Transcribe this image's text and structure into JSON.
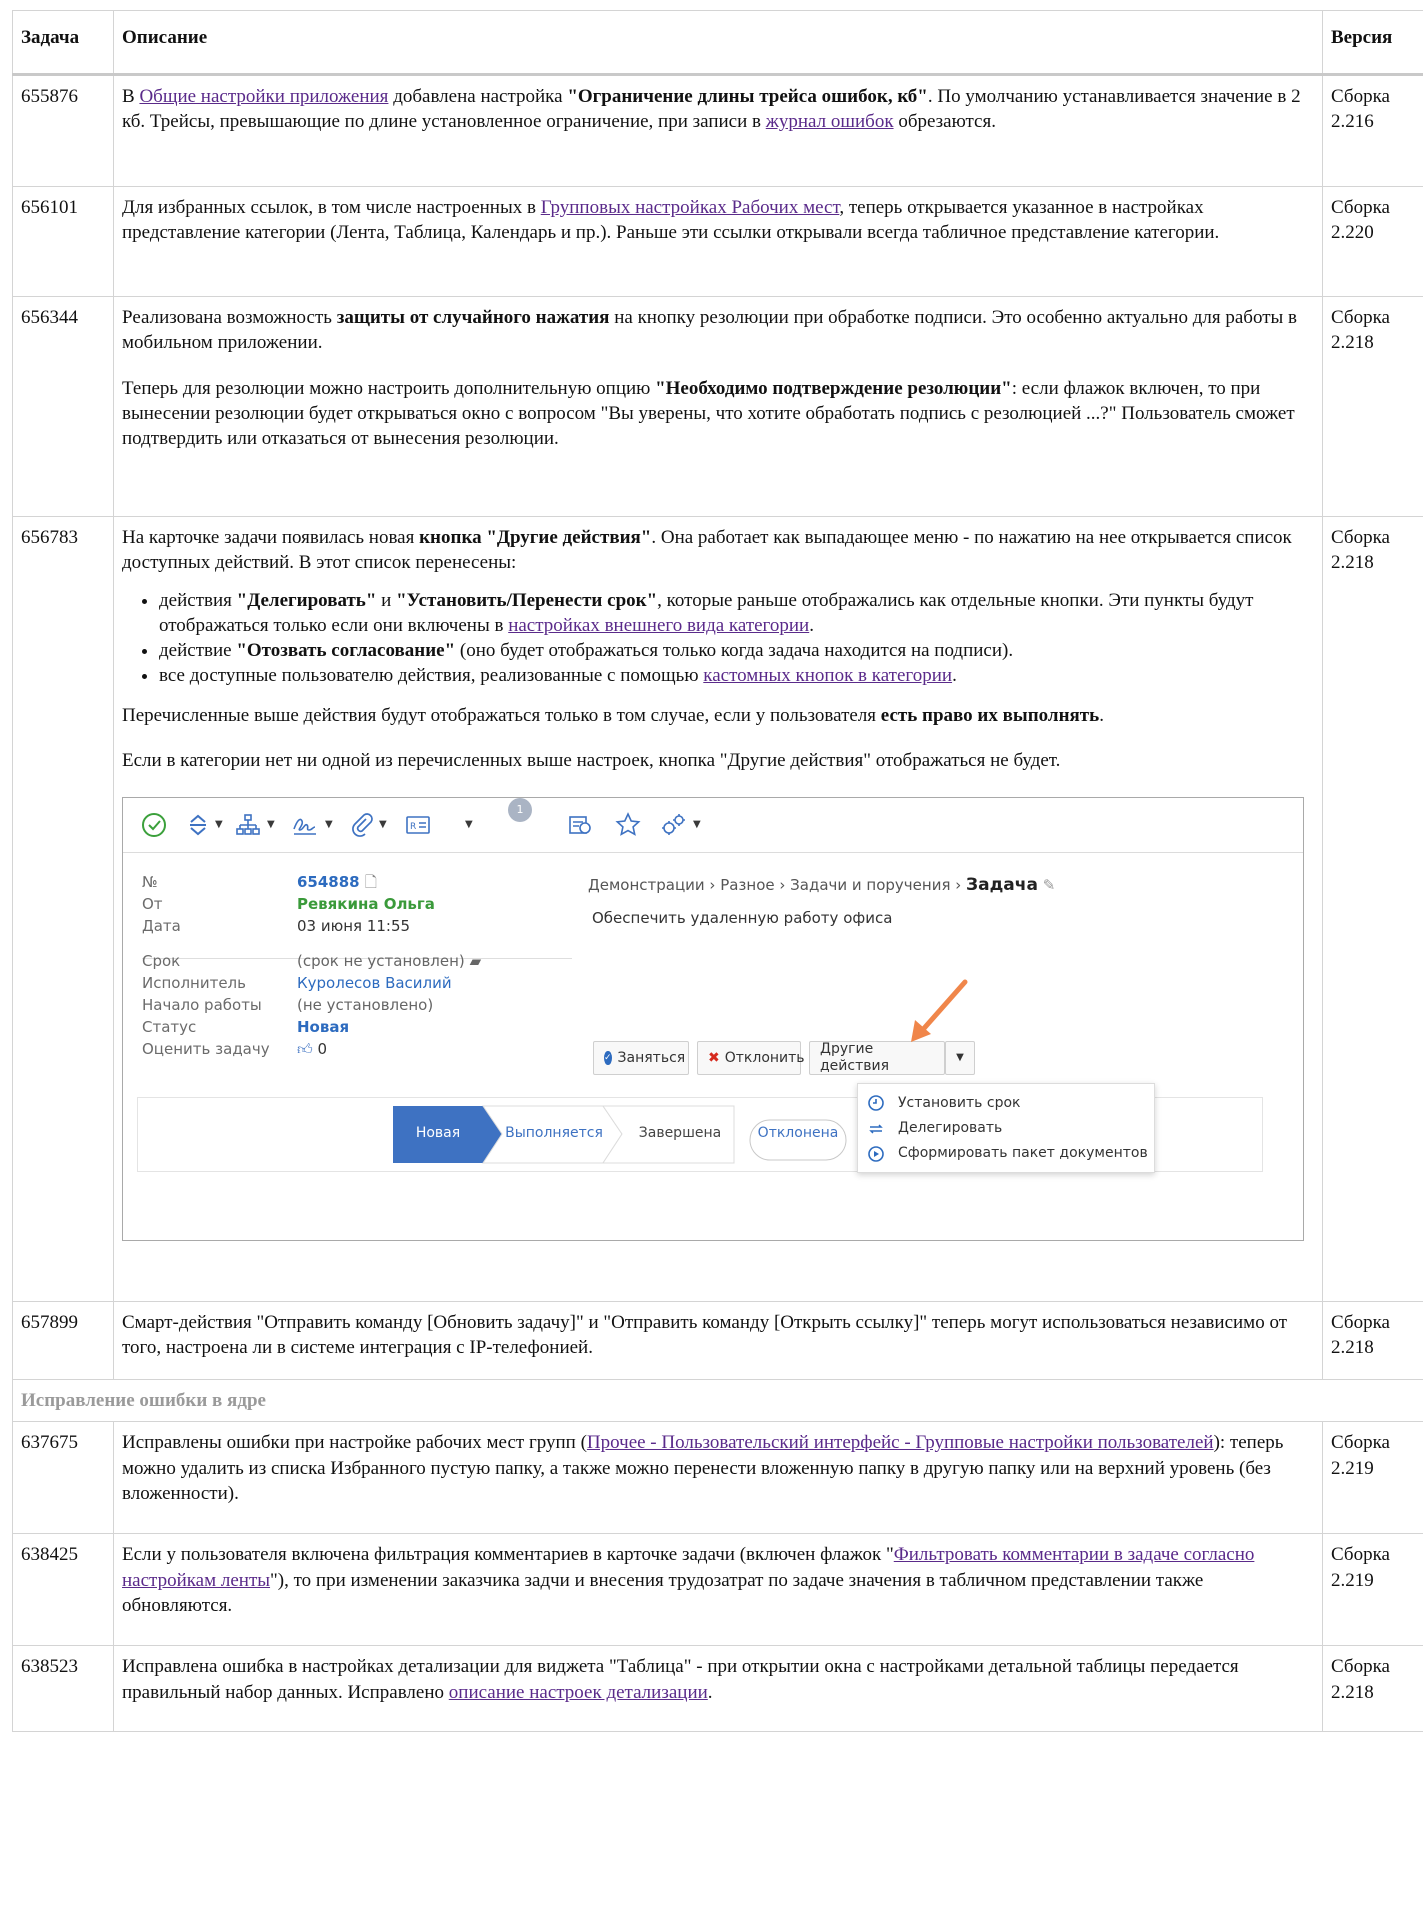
{
  "headers": {
    "task": "Задача",
    "desc": "Описание",
    "version": "Версия"
  },
  "rows": [
    {
      "id": "655876",
      "version": "Сборка 2.216",
      "p1a": "В ",
      "link1": "Общие настройки приложения",
      "p1b": " добавлена настройка ",
      "bold1": "\"Ограничение длины трейса ошибок, кб\"",
      "p1c": ". По умолчанию устанавливается значение в 2 кб. Трейсы, превышающие по длине установленное ограничение, при записи в ",
      "link2": "журнал ошибок",
      "p1d": " обрезаются."
    },
    {
      "id": "656101",
      "version": "Сборка 2.220",
      "p1a": "Для избранных ссылок, в том числе настроенных в ",
      "link1": "Групповых настройках Рабочих мест",
      "p1b": ", теперь открывается указанное в настройках представление категории (Лента, Таблица, Календарь и пр.). Раньше эти ссылки открывали всегда табличное представление категории."
    },
    {
      "id": "656344",
      "version": "Сборка 2.218",
      "p1a": "Реализована возможность ",
      "bold1": "защиты от случайного нажатия",
      "p1b": " на кнопку резолюции при обработке подписи. Это особенно актуально для работы в мобильном приложении.",
      "p2a": "Теперь для резолюции можно настроить дополнительную опцию ",
      "bold2": "\"Необходимо подтверждение резолюции\"",
      "p2b": ": если флажок включен, то при вынесении резолюции будет открываться окно с вопросом \"Вы уверены, что хотите обработать подпись с резолюцией ...?\" Пользователь сможет подтвердить или отказаться от вынесения резолюции."
    },
    {
      "id": "656783",
      "version": "Сборка 2.218",
      "p1a": "На карточке задачи появилась новая ",
      "bold1": "кнопка \"Другие действия\"",
      "p1b": ". Она работает как выпадающее меню - по нажатию на нее открывается список доступных действий. В этот список перенесены:",
      "li1a": "действия ",
      "li1b": "\"Делегировать\"",
      "li1c": " и ",
      "li1d": "\"Установить/Перенести срок\"",
      "li1e": ", которые раньше отображались как отдельные кнопки. Эти пункты будут отображаться только если они включены в ",
      "li1link": "настройках внешнего вида категории",
      "li1f": ".",
      "li2a": "действие ",
      "li2b": "\"Отозвать согласование\"",
      "li2c": " (оно будет отображаться только когда задача находится на подписи).",
      "li3a": "все доступные пользователю действия, реализованные с помощью ",
      "li3link": "кастомных кнопок в категории",
      "li3b": ".",
      "p2a": "Перечисленные выше действия будут отображаться только в том случае, если у пользователя ",
      "bold2": "есть право их выполнять",
      "p2b": ".",
      "p3": "Если в категории нет ни одной из перечисленных выше настроек, кнопка \"Другие действия\" отображаться не будет."
    },
    {
      "id": "657899",
      "version": "Сборка 2.218",
      "p1a": "Смарт-действия \"Отправить команду [Обновить задачу]\" и \"Отправить команду [Открыть ссылку]\" теперь могут использоваться независимо от того, настроена ли в системе интеграция с IP-телефонией."
    }
  ],
  "section_title": "Исправление ошибки в ядре",
  "rows2": [
    {
      "id": "637675",
      "version": "Сборка 2.219",
      "p1a": "Исправлены ошибки при настройке рабочих мест групп (",
      "link1": "Прочее - Пользовательский интерфейс - Групповые настройки пользователей",
      "p1b": "): теперь можно удалить из списка Избранного пустую папку, а также можно перенести вложенную папку в другую папку или на верхний уровень (без вложенности)."
    },
    {
      "id": "638425",
      "version": "Сборка 2.219",
      "p1a": "Если у пользователя включена фильтрация комментариев в карточке задачи (включен флажок \"",
      "link1": "Фильтровать комментарии в задаче согласно настройкам ленты",
      "p1b": "\"), то при изменении заказчика задчи и внесения трудозатрат по задаче значения в табличном представлении также обновляются."
    },
    {
      "id": "638523",
      "version": "Сборка 2.218",
      "p1a": "Исправлена ошибка в настройках детализации для виджета \"Таблица\" - при открытии окна с настройками детальной таблицы передается правильный набор данных. Исправлено ",
      "link1": "описание настроек детализации",
      "p1b": "."
    }
  ],
  "screenshot": {
    "badge": "1",
    "fields": [
      {
        "label": "№",
        "value": "654888"
      },
      {
        "label": "От",
        "value": "Ревякина Ольга"
      },
      {
        "label": "Дата",
        "value": "03 июня 11:55"
      },
      {
        "label": "Срок",
        "value": "(срок не установлен)"
      },
      {
        "label": "Исполнитель",
        "value": "Куролесов Василий"
      },
      {
        "label": "Начало работы",
        "value": "(не установлено)"
      },
      {
        "label": "Статус",
        "value": "Новая"
      },
      {
        "label": "Оценить задачу",
        "value": "0"
      }
    ],
    "breadcrumb": "Демонстрации › Разное › Задачи и поручения ›",
    "breadcrumb_current": "Задача",
    "subject": "Обеспечить удаленную работу офиса",
    "buttons": {
      "take": "Заняться",
      "reject": "Отклонить",
      "other": "Другие действия"
    },
    "menu": [
      "Установить срок",
      "Делегировать",
      "Сформировать пакет документов"
    ],
    "stages": [
      "Новая",
      "Выполняется",
      "Завершена",
      "Отклонена"
    ],
    "colors": {
      "primary": "#3e72c2",
      "arrow": "#f0864a",
      "green": "#3a9a3a",
      "red": "#d62a1e"
    }
  }
}
